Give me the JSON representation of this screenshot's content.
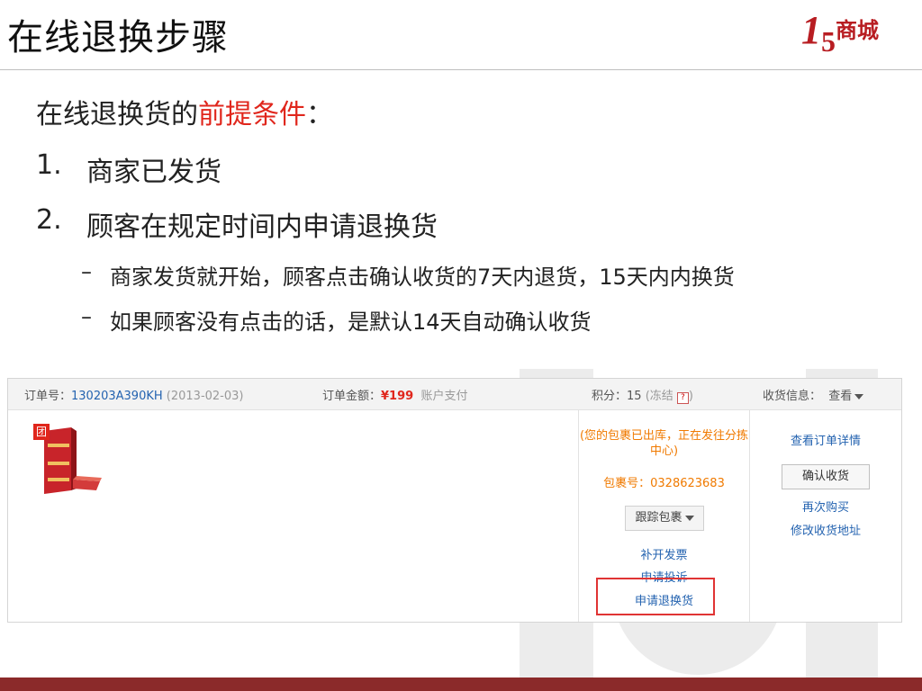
{
  "title": "在线退换步骤",
  "logo": {
    "num1": "1",
    "num2": "5",
    "text": "商城"
  },
  "prereq": {
    "prefix": "在线退换货的",
    "highlight": "前提条件",
    "suffix": "："
  },
  "items": [
    {
      "num": "1.",
      "text": "商家已发货"
    },
    {
      "num": "2.",
      "text": "顾客在规定时间内申请退换货"
    }
  ],
  "subitems": [
    {
      "dash": "–",
      "text": "商家发货就开始，顾客点击确认收货的7天内退货，15天内内换货"
    },
    {
      "dash": "–",
      "text": "如果顾客没有点击的话，是默认14天自动确认收货"
    }
  ],
  "order": {
    "order_no_label": "订单号：",
    "order_no": "130203A390KH",
    "order_date": "(2013-02-03)",
    "amount_label": "订单金额：",
    "amount": "¥199",
    "payment": "账户支付",
    "points_label": "积分：",
    "points": "15",
    "frozen": "(冻结",
    "frozen_q": "?",
    "frozen_end": ")",
    "receive_label": "收货信息：",
    "view_label": "查看",
    "tuan_badge": "团",
    "pkg_status": "(您的包裹已出库，正在发往分拣中心)",
    "pkg_no": "包裹号：0328623683",
    "track_label": "跟踪包裹",
    "invoice_link": "补开发票",
    "complaint_link": "申请投诉",
    "refund_link": "申请退换货",
    "detail_link": "查看订单详情",
    "confirm_button": "确认收货",
    "rebuy_link": "再次购买",
    "address_link": "修改收货地址"
  },
  "colors": {
    "accent": "#e0261c",
    "link": "#2463b0",
    "brand": "#b81d22",
    "footer": "#8b2a2a"
  }
}
